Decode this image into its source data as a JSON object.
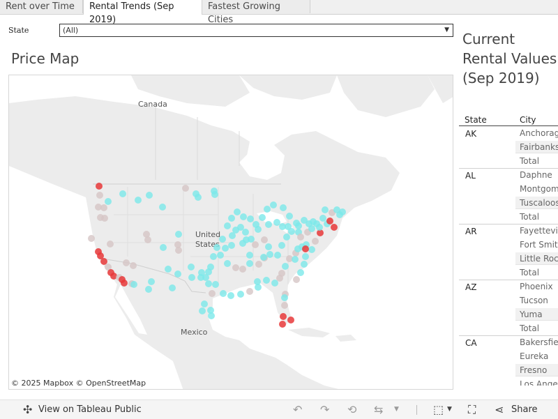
{
  "tabs": [
    "Rent over Time",
    "Rental Trends (Sep 2019)",
    "Fastest Growing Cities"
  ],
  "filter": {
    "label": "State",
    "value": "(All)"
  },
  "map": {
    "title": "Price Map",
    "labels": {
      "canada": "Canada",
      "united_states": "United\nStates",
      "mexico": "Mexico"
    },
    "attribution": "© 2025 Mapbox  © OpenStreetMap"
  },
  "side_panel": {
    "title": "Current Rental Values (Sep 2019)",
    "columns": [
      "State",
      "City"
    ],
    "groups": [
      {
        "state": "AK",
        "cities": [
          "Anchorage",
          "Fairbanks",
          "Total"
        ]
      },
      {
        "state": "AL",
        "cities": [
          "Daphne",
          "Montgomery",
          "Tuscaloosa",
          "Total"
        ]
      },
      {
        "state": "AR",
        "cities": [
          "Fayetteville",
          "Fort Smith",
          "Little Rock",
          "Total"
        ]
      },
      {
        "state": "AZ",
        "cities": [
          "Phoenix",
          "Tucson",
          "Yuma",
          "Total"
        ]
      },
      {
        "state": "CA",
        "cities": [
          "Bakersfield",
          "Eureka",
          "Fresno",
          "Los Angeles"
        ]
      }
    ]
  },
  "footer": {
    "view_label": "View on Tableau Public",
    "share_label": "Share",
    "icons": [
      "tableau-icon",
      "undo-icon",
      "redo-icon",
      "revert-icon",
      "refresh-icon",
      "download-icon",
      "fullscreen-icon",
      "share-icon"
    ]
  },
  "colors": {
    "low": "#7ce8ea",
    "mid": "#d6c6c6",
    "high": "#e8383a",
    "water": "#ffffff",
    "land": "#ececec"
  }
}
